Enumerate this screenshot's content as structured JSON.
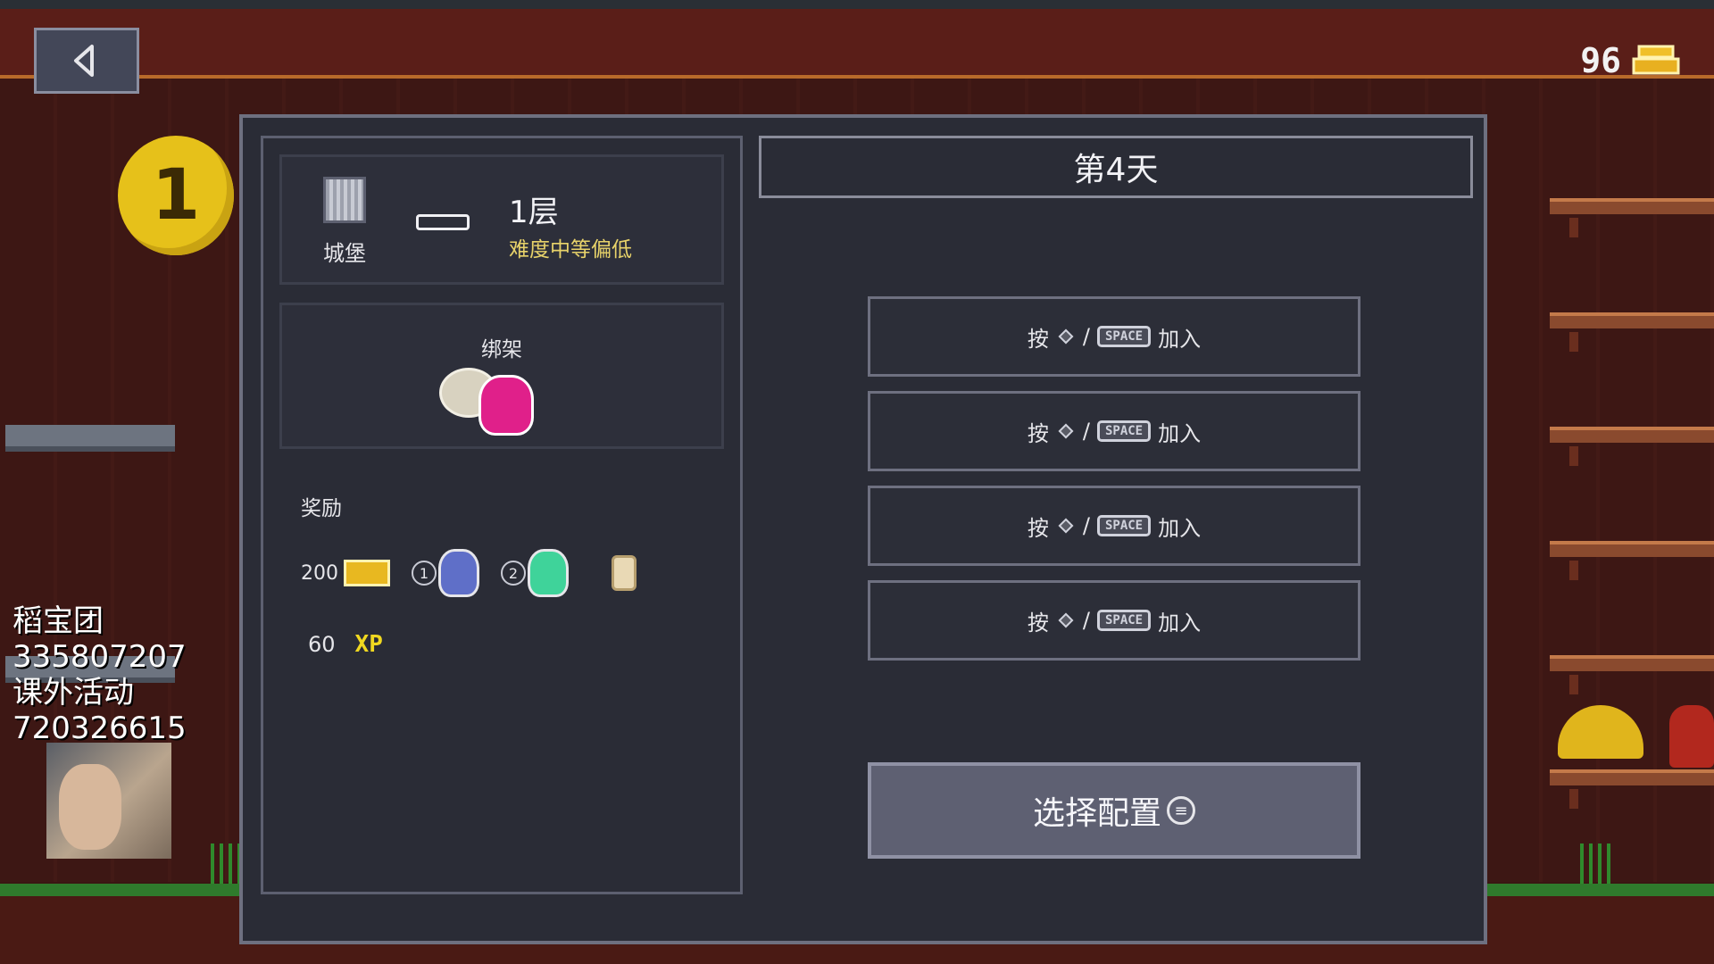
{
  "hud": {
    "gold": "96",
    "level_badge": "1"
  },
  "overlay": {
    "lines": [
      "稻宝团",
      "335807207",
      "课外活动",
      "720326615"
    ]
  },
  "mission": {
    "location": "城堡",
    "floor": "1层",
    "difficulty": "难度中等偏低",
    "type": "绑架",
    "rewards_label": "奖励",
    "reward_gold": "200",
    "reward_badge_1": "1",
    "reward_badge_2": "2",
    "reward_xp": "60",
    "xp_label": "XP"
  },
  "lobby": {
    "day": "第4天",
    "join_prefix": "按",
    "join_sep": "/",
    "join_key": "SPACE",
    "join_suffix": "加入",
    "config_button": "选择配置",
    "config_icon": "≡"
  },
  "colors": {
    "accent_gold": "#e6c11a",
    "difficulty": "#e8d36a",
    "xp": "#f0d820",
    "kidnapper": "#e0208a"
  },
  "icons": [
    "back-arrow-icon",
    "gold-bar-icon",
    "castle-icon",
    "gamepad-button-icon",
    "menu-button-icon",
    "scroll-icon"
  ]
}
